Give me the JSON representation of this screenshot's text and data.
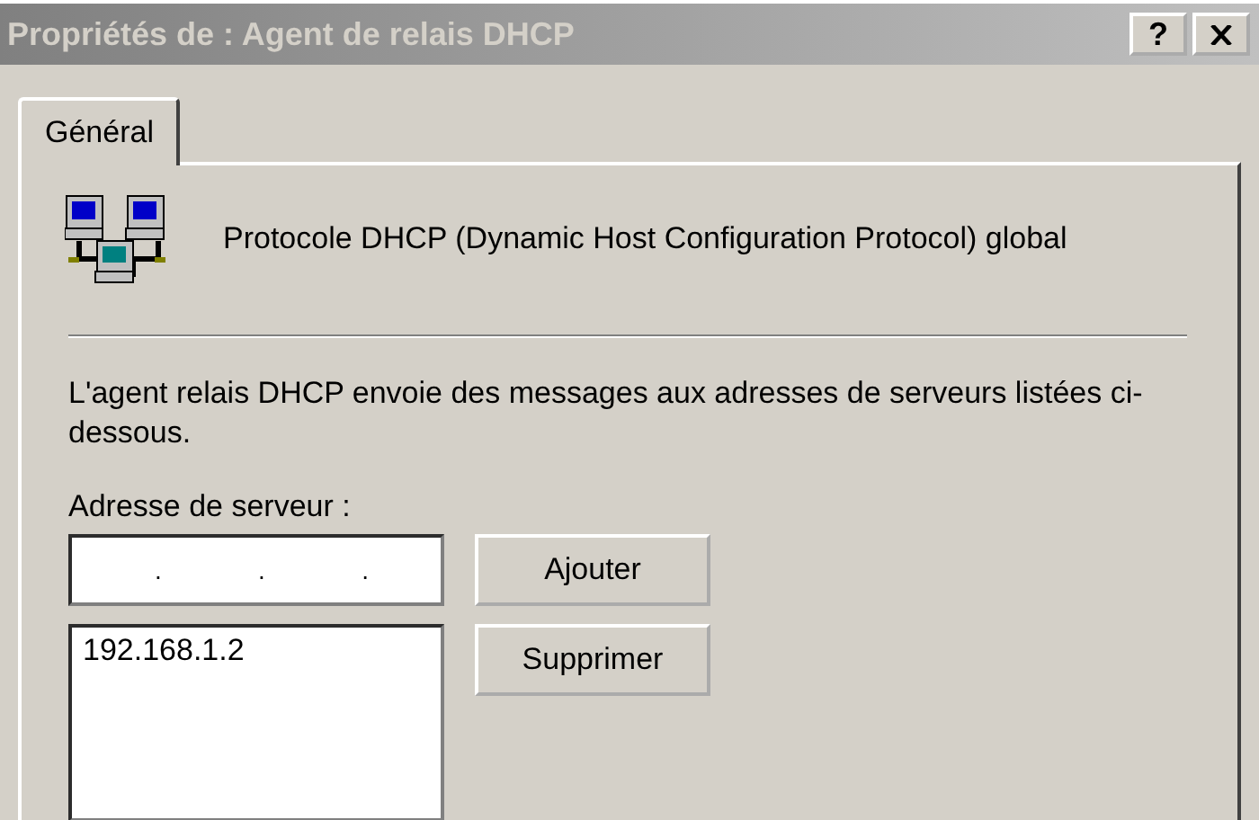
{
  "window": {
    "title": "Propriétés de : Agent de relais DHCP",
    "help_button": "?"
  },
  "tabs": [
    {
      "label": "Général",
      "selected": true
    }
  ],
  "header": {
    "title": "Protocole DHCP (Dynamic Host Configuration Protocol) global"
  },
  "description": "L'agent relais DHCP envoie des messages aux adresses de serveurs listées ci-dessous.",
  "server_address": {
    "label": "Adresse de serveur :",
    "separators": [
      ".",
      ".",
      "."
    ]
  },
  "buttons": [
    {
      "label": "Ajouter"
    },
    {
      "label": "Supprimer"
    }
  ],
  "servers": [
    {
      "address": "192.168.1.2",
      "selected": false
    }
  ]
}
